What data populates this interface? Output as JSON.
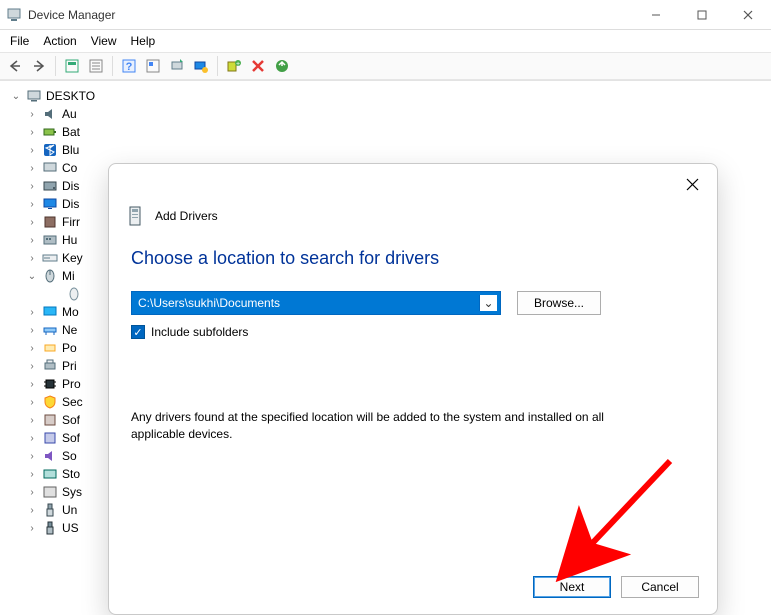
{
  "window": {
    "title": "Device Manager"
  },
  "menu": {
    "file": "File",
    "action": "Action",
    "view": "View",
    "help": "Help"
  },
  "tree": {
    "root": "DESKTO",
    "items": [
      {
        "label": "Au",
        "icon": "audio"
      },
      {
        "label": "Bat",
        "icon": "battery"
      },
      {
        "label": "Blu",
        "icon": "bluetooth"
      },
      {
        "label": "Co",
        "icon": "computer"
      },
      {
        "label": "Dis",
        "icon": "disk"
      },
      {
        "label": "Dis",
        "icon": "display"
      },
      {
        "label": "Firr",
        "icon": "firmware"
      },
      {
        "label": "Hu",
        "icon": "hid"
      },
      {
        "label": "Key",
        "icon": "keyboard"
      },
      {
        "label": "Mi",
        "icon": "mouse",
        "expanded": true,
        "children": [
          {
            "label": "",
            "icon": "mouse-dev"
          }
        ]
      },
      {
        "label": "Mo",
        "icon": "monitor"
      },
      {
        "label": "Ne",
        "icon": "network"
      },
      {
        "label": "Po",
        "icon": "port"
      },
      {
        "label": "Pri",
        "icon": "printer"
      },
      {
        "label": "Pro",
        "icon": "processor"
      },
      {
        "label": "Sec",
        "icon": "security"
      },
      {
        "label": "Sof",
        "icon": "software"
      },
      {
        "label": "Sof",
        "icon": "software2"
      },
      {
        "label": "So",
        "icon": "sound"
      },
      {
        "label": "Sto",
        "icon": "storage"
      },
      {
        "label": "Sys",
        "icon": "system"
      },
      {
        "label": "Un",
        "icon": "usb"
      },
      {
        "label": "US",
        "icon": "usb2"
      }
    ]
  },
  "dialog": {
    "title": "Add Drivers",
    "heading": "Choose a location to search for drivers",
    "path": "C:\\Users\\sukhi\\Documents",
    "browse": "Browse...",
    "include_label": "Include subfolders",
    "include_checked": true,
    "description": "Any drivers found at the specified location will be added to the system and installed on all applicable devices.",
    "next": "Next",
    "cancel": "Cancel"
  }
}
